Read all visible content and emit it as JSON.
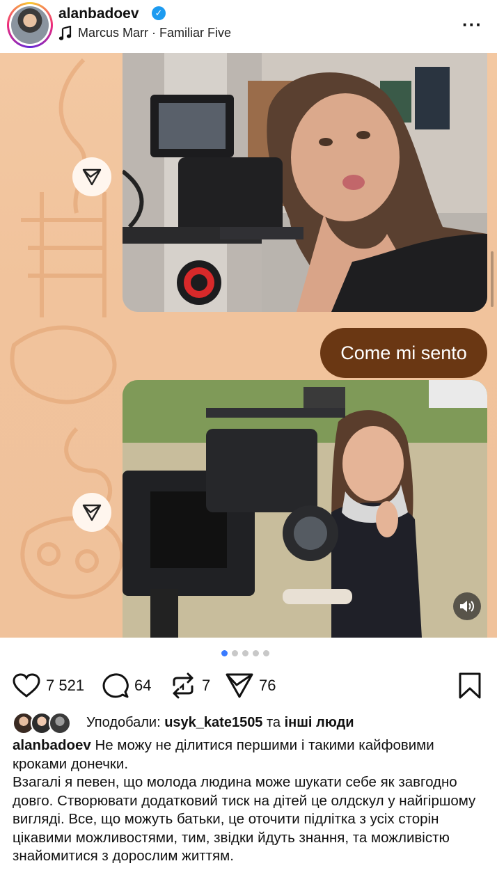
{
  "header": {
    "username": "alanbadoev",
    "audio": "Marcus Marr · Familiar Five"
  },
  "media": {
    "message_text": "Come mi sento",
    "slide_count": 5,
    "active_slide": 1
  },
  "actions": {
    "likes": "7 521",
    "comments": "64",
    "reposts": "7",
    "shares": "76"
  },
  "liked_by": {
    "prefix": "Уподобали:",
    "user": "usyk_kate1505",
    "conj": "та",
    "others": "інші люди"
  },
  "caption": {
    "author": "alanbadoev",
    "text": "Не можу не ділитися першими і такими кайфовими кроками донечки.",
    "paragraph": "Взагалі я певен, що молода людина може шукати себе як завгодно довго. Створювати додатковий тиск на дітей це олдскул у найгіршому вигляді. Все, що можуть батьки, це оточити підлітка з усіх сторін цікавими можливостями, тим, звідки йдуть знання, та можливістю знайомитися з дорослим життям."
  },
  "colors": {
    "background": "#f1c39c",
    "message_bubble": "#6a3713",
    "active_dot": "#3a7bff"
  }
}
